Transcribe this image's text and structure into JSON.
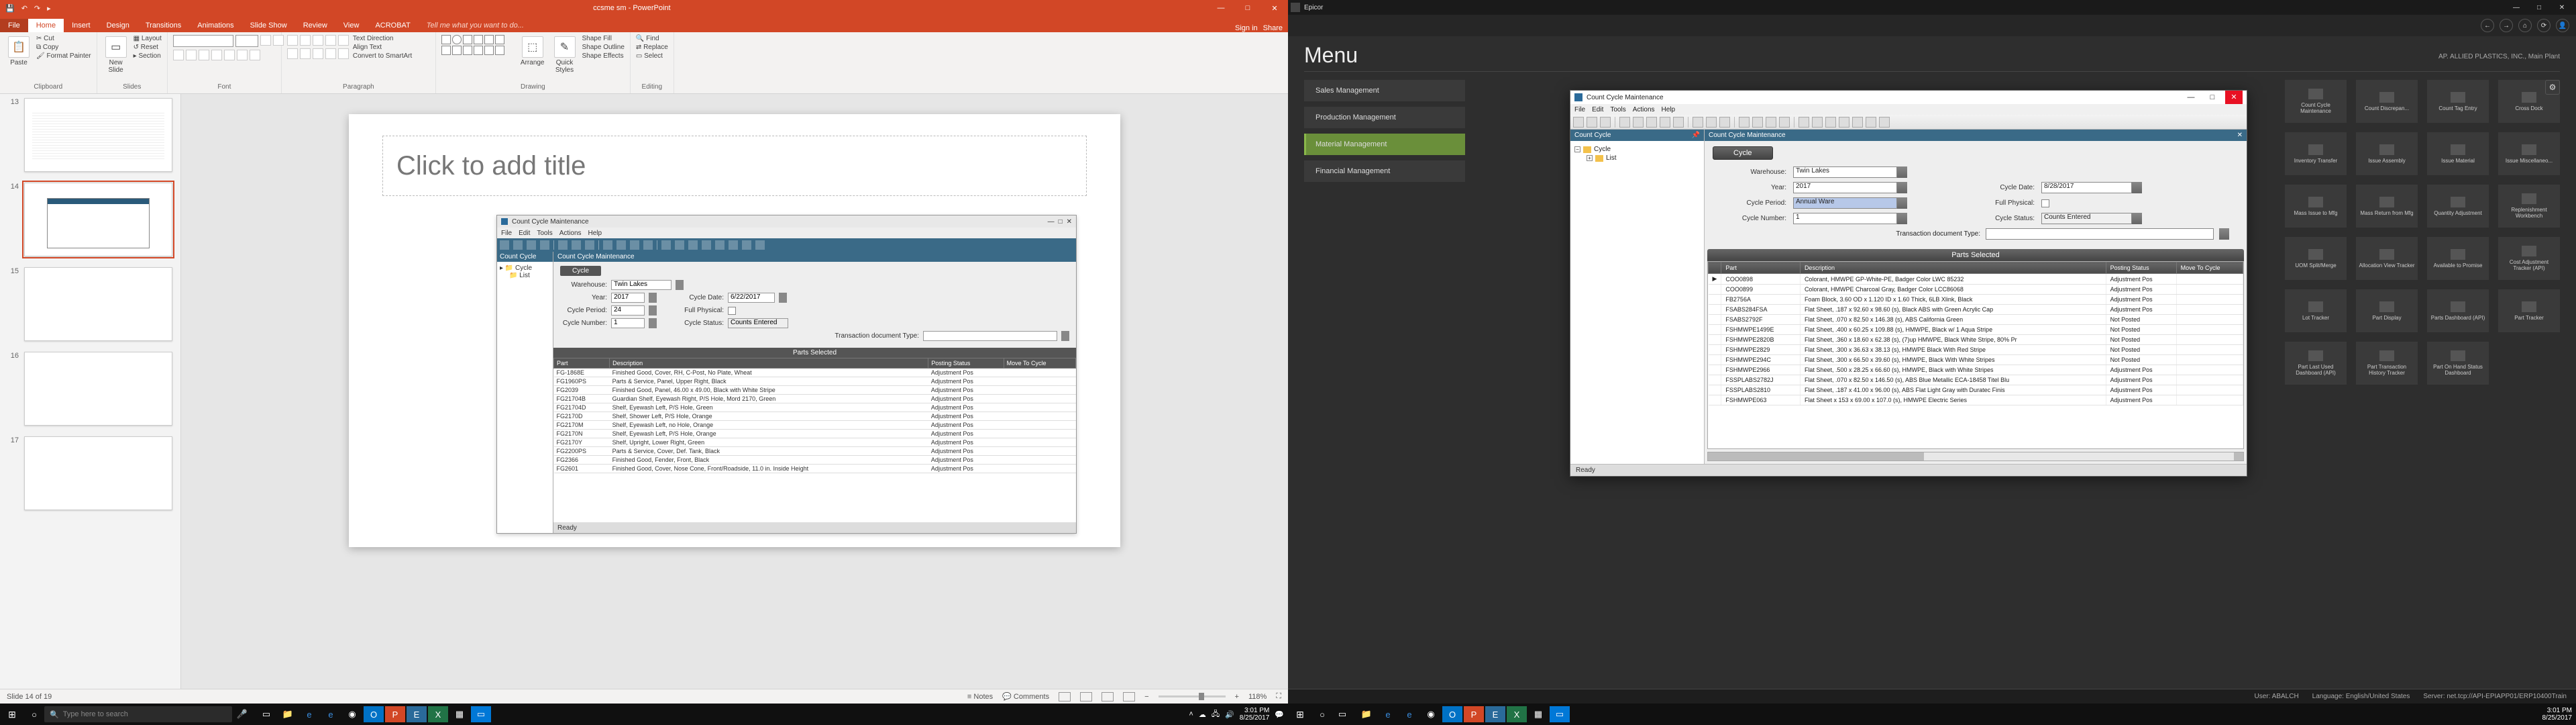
{
  "left": {
    "titlebar": {
      "doc": "ccsme sm - PowerPoint",
      "min": "—",
      "max": "□",
      "close": "✕",
      "qat_save": "💾",
      "qat_undo": "↶",
      "qat_redo": "↷",
      "qat_start": "▸"
    },
    "tabs": {
      "file": "File",
      "home": "Home",
      "insert": "Insert",
      "design": "Design",
      "transitions": "Transitions",
      "animations": "Animations",
      "slideshow": "Slide Show",
      "review": "Review",
      "view": "View",
      "acrobat": "ACROBAT",
      "tell": "Tell me what you want to do...",
      "signin": "Sign in",
      "share": "Share"
    },
    "ribbon": {
      "clipboard": {
        "label": "Clipboard",
        "paste": "Paste",
        "cut": "Cut",
        "copy": "Copy",
        "fp": "Format Painter"
      },
      "slides": {
        "label": "Slides",
        "new": "New\nSlide",
        "layout": "Layout",
        "reset": "Reset",
        "section": "Section"
      },
      "font": {
        "label": "Font"
      },
      "paragraph": {
        "label": "Paragraph",
        "dir": "Text Direction",
        "align": "Align Text",
        "smart": "Convert to SmartArt"
      },
      "drawing": {
        "label": "Drawing",
        "arrange": "Arrange",
        "quick": "Quick\nStyles",
        "fill": "Shape Fill",
        "outline": "Shape Outline",
        "effects": "Shape Effects"
      },
      "editing": {
        "label": "Editing",
        "find": "Find",
        "replace": "Replace",
        "select": "Select"
      }
    },
    "thumbs": {
      "n13": "13",
      "n14": "14",
      "n15": "15",
      "n16": "16",
      "n17": "17"
    },
    "slide": {
      "title_ph": "Click to add title"
    },
    "embed": {
      "title": "Count Cycle Maintenance",
      "menu": {
        "file": "File",
        "edit": "Edit",
        "tools": "Tools",
        "actions": "Actions",
        "help": "Help"
      },
      "tree_hdr": "Count Cycle",
      "tree": {
        "cycle": "Cycle",
        "list": "List"
      },
      "content_hdr": "Count Cycle Maintenance",
      "cycle_btn": "Cycle",
      "labels": {
        "warehouse": "Warehouse:",
        "year": "Year:",
        "period": "Cycle Period:",
        "number": "Cycle Number:",
        "date": "Cycle Date:",
        "full": "Full Physical:",
        "status": "Cycle Status:",
        "trans": "Transaction document Type:"
      },
      "vals": {
        "warehouse": "Twin Lakes",
        "year": "2017",
        "period": "24",
        "number": "1",
        "date": "6/22/2017",
        "status": "Counts Entered"
      },
      "parts_hdr": "Parts Selected",
      "cols": {
        "part": "Part",
        "desc": "Description",
        "pstat": "Posting Status",
        "move": "Move To Cycle"
      },
      "rows": [
        {
          "p": "FG-1868E",
          "d": "Finished Good, Cover, RH, C-Post, No Plate, Wheat",
          "s": "Adjustment Pos"
        },
        {
          "p": "FG1960PS",
          "d": "Parts & Service, Panel, Upper Right, Black",
          "s": "Adjustment Pos"
        },
        {
          "p": "FG2039",
          "d": "Finished Good, Panel, 46.00 x 49.00, Black with White Stripe",
          "s": "Adjustment Pos"
        },
        {
          "p": "FG21704B",
          "d": "Guardian Shelf, Eyewash Right, P/S Hole, Mord 2170, Green",
          "s": "Adjustment Pos"
        },
        {
          "p": "FG21704D",
          "d": "Shelf, Eyewash Left, P/S Hole, Green",
          "s": "Adjustment Pos"
        },
        {
          "p": "FG2170D",
          "d": "Shelf, Shower Left, P/S Hole, Orange",
          "s": "Adjustment Pos"
        },
        {
          "p": "FG2170M",
          "d": "Shelf, Eyewash Left, no Hole, Orange",
          "s": "Adjustment Pos"
        },
        {
          "p": "FG2170N",
          "d": "Shelf, Eyewash Left, P/S Hole, Orange",
          "s": "Adjustment Pos"
        },
        {
          "p": "FG2170Y",
          "d": "Shelf, Upright, Lower Right, Green",
          "s": "Adjustment Pos"
        },
        {
          "p": "FG2200PS",
          "d": "Parts & Service, Cover, Def. Tank, Black",
          "s": "Adjustment Pos"
        },
        {
          "p": "FG2366",
          "d": "Finished Good, Fender, Front, Black",
          "s": "Adjustment Pos"
        },
        {
          "p": "FG2601",
          "d": "Finished Good, Cover, Nose Cone, Front/Roadside, 11.0 in. Inside Height",
          "s": "Adjustment Pos"
        }
      ],
      "status": "Ready"
    },
    "status": {
      "slide": "Slide 14 of 19",
      "lang": "",
      "notes": "Notes",
      "comments": "Comments",
      "zoom": "118%"
    },
    "taskbar": {
      "search": "Type here to search",
      "time": "3:01 PM",
      "date": "8/25/2017"
    }
  },
  "right": {
    "titlebar": {
      "app": "Epicor",
      "min": "—",
      "max": "□",
      "close": "✕"
    },
    "menu_title": "Menu",
    "context": "AP. ALLIED PLASTICS, INC., Main Plant",
    "nav": {
      "sales": "Sales Management",
      "production": "Production Management",
      "material": "Material Management",
      "financial": "Financial Management"
    },
    "tiles": [
      "Count Cycle Maintenance",
      "Count Discrepan...",
      "Count Tag Entry",
      "Cross Dock",
      "Inventory Transfer",
      "Issue Assembly",
      "Issue Material",
      "Issue Miscellaneo...",
      "Mass Issue to Mfg",
      "Mass Return from Mfg",
      "Quantity Adjustment",
      "Replenishment Workbench",
      "UOM Split/Merge",
      "Allocation View Tracker",
      "Available to Promise",
      "Cost Adjustment Tracker (API)",
      "Lot Tracker",
      "Part Display",
      "Parts Dashboard (API)",
      "Part Tracker",
      "Part Last Used Dashboard (API)",
      "Part Transaction History Tracker",
      "Part On Hand Status Dashboard",
      ""
    ],
    "window": {
      "title": "Count Cycle Maintenance",
      "menu": {
        "file": "File",
        "edit": "Edit",
        "tools": "Tools",
        "actions": "Actions",
        "help": "Help"
      },
      "tree_hdr": "Count Cycle",
      "tree": {
        "cycle": "Cycle",
        "list": "List"
      },
      "content_hdr": "Count Cycle Maintenance",
      "cycle_btn": "Cycle",
      "labels": {
        "warehouse": "Warehouse:",
        "year": "Year:",
        "period": "Cycle Period:",
        "number": "Cycle Number:",
        "date": "Cycle Date:",
        "full": "Full Physical:",
        "status": "Cycle Status:",
        "trans": "Transaction document Type:"
      },
      "vals": {
        "warehouse": "Twin Lakes",
        "year": "2017",
        "period": "Annual Ware",
        "number": "1",
        "date": "8/28/2017",
        "status": "Counts Entered"
      },
      "parts_hdr": "Parts Selected",
      "cols": {
        "part": "Part",
        "desc": "Description",
        "pstat": "Posting Status",
        "move": "Move To Cycle"
      },
      "rows": [
        {
          "p": "COO0898",
          "d": "Colorant, HMWPE GP-White-PE, Badger Color LWC 85232",
          "s": "Adjustment Pos"
        },
        {
          "p": "COO0899",
          "d": "Colorant, HMWPE Charcoal Gray, Badger Color LCC86068",
          "s": "Adjustment Pos"
        },
        {
          "p": "FB2756A",
          "d": "Foam Block, 3.60 OD x 1.120 ID x 1.60 Thick, 6LB Xlink, Black",
          "s": "Adjustment Pos"
        },
        {
          "p": "FSABS284FSA",
          "d": "Flat Sheet, .187 x 92.60 x 98.60 (s), Black ABS with Green Acrylic Cap",
          "s": "Adjustment Pos"
        },
        {
          "p": "FSABS2792F",
          "d": "Flat Sheet, .070 x 82.50 x 146.38 (s), ABS California Green",
          "s": "Not Posted"
        },
        {
          "p": "FSHMWPE1499E",
          "d": "Flat Sheet, .400 x 60.25 x 109.88 (s), HMWPE, Black w/ 1 Aqua Stripe",
          "s": "Not Posted"
        },
        {
          "p": "FSHMWPE2820B",
          "d": "Flat Sheet, .360 x 18.60 x 62.38 (s), (7)up HMWPE, Black White Stripe, 80% Pr",
          "s": "Not Posted"
        },
        {
          "p": "FSHMWPE2829",
          "d": "Flat Sheet, .300 x 36.63 x 38.13 (s), HMWPE Black With Red Stripe",
          "s": "Not Posted"
        },
        {
          "p": "FSHMWPE294C",
          "d": "Flat Sheet, .300 x 66.50 x 39.60 (s), HMWPE, Black With White Stripes",
          "s": "Not Posted"
        },
        {
          "p": "FSHMWPE2966",
          "d": "Flat Sheet, .500 x 28.25 x 66.60 (s), HMWPE, Black with White Stripes",
          "s": "Adjustment Pos"
        },
        {
          "p": "FSSPLABS2782J",
          "d": "Flat Sheet, .070 x 82.50 x 146.50 (s), ABS Blue Metallic ECA-18458 Titel Blu",
          "s": "Adjustment Pos"
        },
        {
          "p": "FSSPLABS2810",
          "d": "Flat Sheet, .187 x 41.00 x 96.00 (s), ABS Flat Light Gray with Duratec Finis",
          "s": "Adjustment Pos"
        },
        {
          "p": "FSHMWPE063",
          "d": "Flat Sheet x 153 x 69.00 x 107.0 (s), HMWPE Electric Series",
          "s": "Adjustment Pos"
        }
      ],
      "status": "Ready"
    },
    "statusbar": {
      "user_l": "User:",
      "user": "ABALCH",
      "lang_l": "Language:",
      "lang": "English/United States",
      "srv_l": "Server:",
      "srv": "net.tcp://API-EPIAPP01/ERP10400Train"
    },
    "taskbar": {
      "time": "3:01 PM",
      "date": "8/25/2017"
    }
  }
}
